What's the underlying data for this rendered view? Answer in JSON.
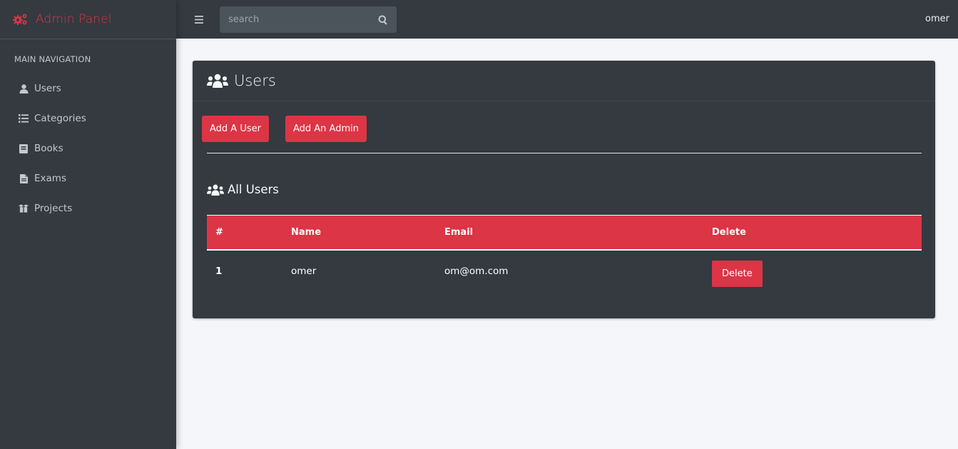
{
  "brand": {
    "text": "Admin Panel",
    "icon": "cogs-icon",
    "color": "#dc3545"
  },
  "sidebar": {
    "header": "MAIN NAVIGATION",
    "items": [
      {
        "label": "Users",
        "icon": "user-icon"
      },
      {
        "label": "Categories",
        "icon": "list-icon"
      },
      {
        "label": "Books",
        "icon": "book-icon"
      },
      {
        "label": "Exams",
        "icon": "file-icon"
      },
      {
        "label": "Projects",
        "icon": "box-icon"
      }
    ]
  },
  "topbar": {
    "search_placeholder": "search",
    "user": "omer"
  },
  "main": {
    "title": "Users",
    "buttons": {
      "add_user": "Add A User",
      "add_admin": "Add An Admin"
    },
    "section_title": "All Users",
    "table": {
      "columns": [
        "#",
        "Name",
        "Email",
        "Delete"
      ],
      "rows": [
        {
          "index": "1",
          "name": "omer",
          "email": "om@om.com",
          "action": "Delete"
        }
      ]
    }
  },
  "colors": {
    "accent": "#dc3545",
    "sidebar_bg": "#343a40",
    "content_bg": "#f4f6f9"
  }
}
